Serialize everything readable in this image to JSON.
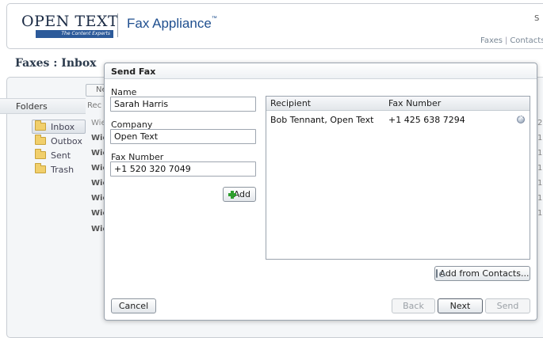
{
  "header": {
    "logo_text": "OPEN TEXT",
    "logo_tagline": "The Content Experts",
    "product": "Fax Appliance",
    "product_tm": "™",
    "corner_text": "S",
    "nav": [
      "Faxes",
      "Contacts"
    ]
  },
  "page": {
    "title": "Faxes : Inbox"
  },
  "background": {
    "new_button_fragment": "Ne",
    "recipient_header_fragment": "Rec",
    "folders_header": "Folders",
    "folders": [
      {
        "label": "Inbox",
        "selected": true
      },
      {
        "label": "Outbox",
        "selected": false
      },
      {
        "label": "Sent",
        "selected": false
      },
      {
        "label": "Trash",
        "selected": false
      }
    ],
    "row_fragments": [
      "Wie",
      "Wie",
      "Wie",
      "Wie",
      "Wie",
      "Wie",
      "Wie",
      "Wie"
    ],
    "right_fragments": [
      "2",
      "1",
      "1",
      "1",
      "1",
      "1",
      "1"
    ]
  },
  "dialog": {
    "title": "Send Fax",
    "name_label": "Name",
    "name_value": "Sarah Harris",
    "company_label": "Company",
    "company_value": "Open Text",
    "fax_label": "Fax Number",
    "fax_value": "+1 520 320 7049",
    "add_label": "Add",
    "table": {
      "columns": [
        "Recipient",
        "Fax Number"
      ],
      "rows": [
        {
          "recipient": "Bob Tennant, Open Text",
          "fax": "+1 425 638 7294"
        }
      ]
    },
    "add_from_contacts_label": "Add from Contacts...",
    "cancel_label": "Cancel",
    "back_label": "Back",
    "next_label": "Next",
    "send_label": "Send"
  }
}
